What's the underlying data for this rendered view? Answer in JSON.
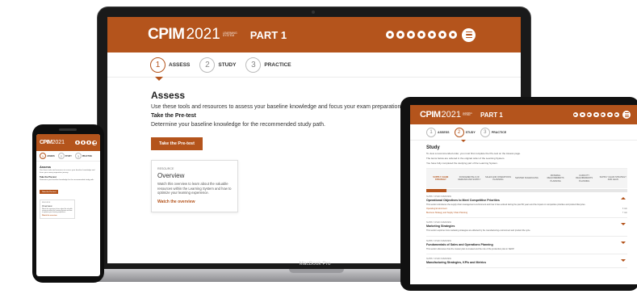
{
  "brand": {
    "logo_bold": "CPIM",
    "logo_year": "2021",
    "logo_tag": "LEARNING SYSTEM",
    "part": "PART 1",
    "accent": "#b4541c",
    "header_icons": [
      "dashboard-icon",
      "book-icon",
      "calendar-icon",
      "chart-icon",
      "flashcard-icon",
      "glossary-icon",
      "resources-icon"
    ]
  },
  "steps": [
    {
      "num": "1",
      "label": "ASSESS"
    },
    {
      "num": "2",
      "label": "STUDY"
    },
    {
      "num": "3",
      "label": "PRACTICE"
    }
  ],
  "laptop": {
    "model": "MacBook Pro",
    "active_step": 1,
    "title": "Assess",
    "intro": "Use these tools and resources to assess your baseline knowledge and focus your exam preparation journey.",
    "subtitle": "Take the Pre-test",
    "subdesc": "Determine your baseline knowledge for the recommended study path.",
    "button": "Take the Pre-test",
    "card": {
      "kicker": "RESOURCE",
      "title": "Overview",
      "desc": "Watch this overview to learn about the valuable resources within the Learning System and how to optimize your learning experience.",
      "link": "Watch the overview"
    }
  },
  "tablet": {
    "active_step": 2,
    "title": "Study",
    "line1": "To view a recommended order, you must first complete the Pre-test on the Assess page.",
    "line2": "The items below are ordered in the original order of the Learning System.",
    "line3": "You have fully completed the studying part of the Learning System.",
    "columns": [
      "SUPPLY CHAIN STRATEGY",
      "FUNDAMENTALS OF DEMAND AND SUPPLY",
      "SALES AND OPERATIONS PLANNING",
      "MASTER SCHEDULING",
      "MATERIAL REQUIREMENTS PLANNING",
      "CAPACITY REQUIREMENTS PLANNING",
      "SUPPLY CHAIN STRATEGY AND LEAN"
    ],
    "sections": [
      {
        "kicker": "SUPPLY CHAIN OVERVIEW",
        "title": "Operational Objectives to Meet Competitive Priorities",
        "desc": "This section introduces the supply chain management environment and how it has evolved during the past 50 years and the impact on competitive priorities and product lifecycles.",
        "rows": [
          [
            "Operating Environment",
            "3 min"
          ],
          [
            "Business Strategy and Supply Chain Planning",
            "7 min"
          ]
        ],
        "open": true
      },
      {
        "kicker": "SUPPLY CHAIN OVERVIEW",
        "title": "Marketing Strategies",
        "desc": "This section explores how marketing strategies are affected by the manufacturing environment and product life cycle.",
        "rows": [],
        "open": false
      },
      {
        "kicker": "SUPPLY CHAIN OVERVIEW",
        "title": "Fundamentals of Sales and Operations Planning",
        "desc": "This section discusses how the master plan is created and the role of the production plan in S&OP.",
        "rows": [],
        "open": false
      },
      {
        "kicker": "SUPPLY CHAIN OVERVIEW",
        "title": "Manufacturing Strategies, KPIs and Metrics",
        "desc": "",
        "rows": [],
        "open": false
      }
    ]
  },
  "phone": {
    "active_step": 1,
    "title": "Assess",
    "intro": "Use these tools and resources to assess your baseline knowledge and focus your exam preparation journey.",
    "subtitle": "Take the Pre-test",
    "subdesc": "Determine your baseline knowledge for the recommended study path.",
    "button": "Take the Pre-test",
    "card": {
      "kicker": "RESOURCE",
      "title": "Overview",
      "desc": "Watch this overview to learn about the valuable resources within the Learning System and how to optimize your learning experience.",
      "link": "Watch the overview"
    }
  }
}
